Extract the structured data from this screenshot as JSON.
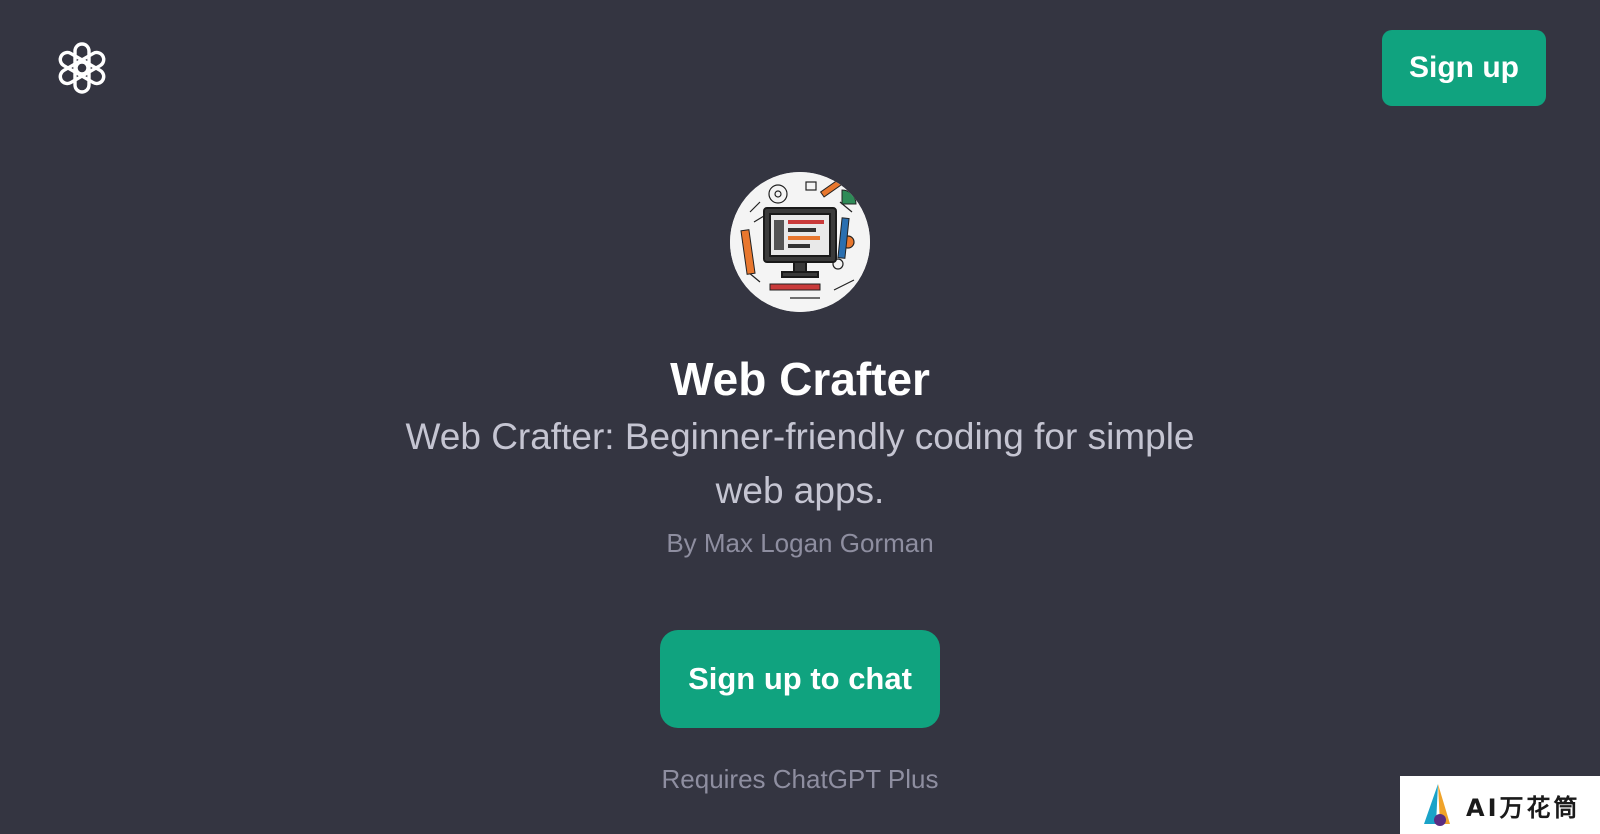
{
  "header": {
    "logo": "openai-logo-icon",
    "signup_label": "Sign up"
  },
  "gpt": {
    "avatar": "web-crafter-avatar",
    "title": "Web Crafter",
    "description": "Web Crafter: Beginner-friendly coding for simple web apps.",
    "author": "By Max Logan Gorman"
  },
  "cta": {
    "signup_chat_label": "Sign up to chat",
    "requirement": "Requires ChatGPT Plus"
  },
  "watermark": {
    "text": "AI万花筒"
  },
  "colors": {
    "background": "#343541",
    "accent": "#10a37f",
    "title": "#ffffff",
    "description": "#c5c5d2",
    "muted": "#8e8ea0"
  }
}
